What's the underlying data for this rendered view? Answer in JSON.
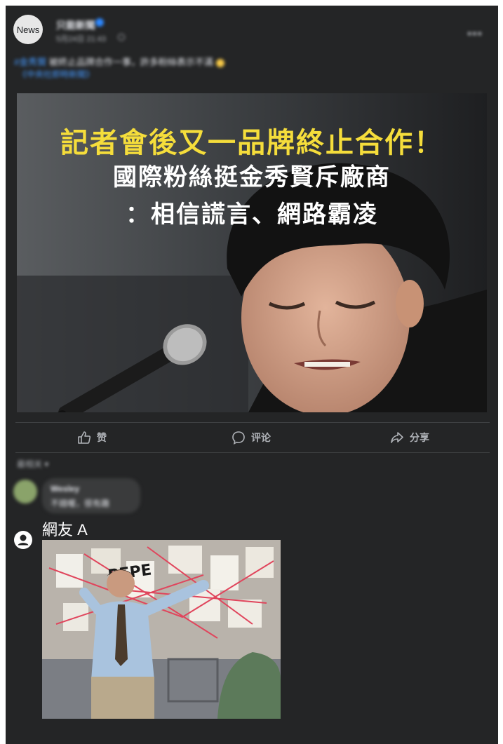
{
  "post": {
    "avatar_text": "News",
    "page_name": "只能新聞",
    "timestamp": "5月24日 21:43",
    "caption_link": "#金秀賢",
    "caption_text": "被終止品牌合作一事，許多粉絲表示不滿",
    "caption_more": "《中央社即時新聞》",
    "more_menu": "•••",
    "image_headline_line1": "記者會後又一品牌終止合作！",
    "image_headline_line2": "國際粉絲挺金秀賢斥廠商",
    "image_headline_line3": "：相信謊言、網路霸凌"
  },
  "actions": {
    "like_label": "赞",
    "comment_label": "评论",
    "share_label": "分享"
  },
  "comments": {
    "sort_label": "最相关 ▾",
    "first": {
      "name": "Wesley",
      "text": "不錯喔，很有趣"
    },
    "reply": {
      "name": "網友 A"
    }
  },
  "colors": {
    "panel_bg": "#242526",
    "headline_yellow": "#f5dd3b",
    "link_blue": "#4599ff"
  }
}
